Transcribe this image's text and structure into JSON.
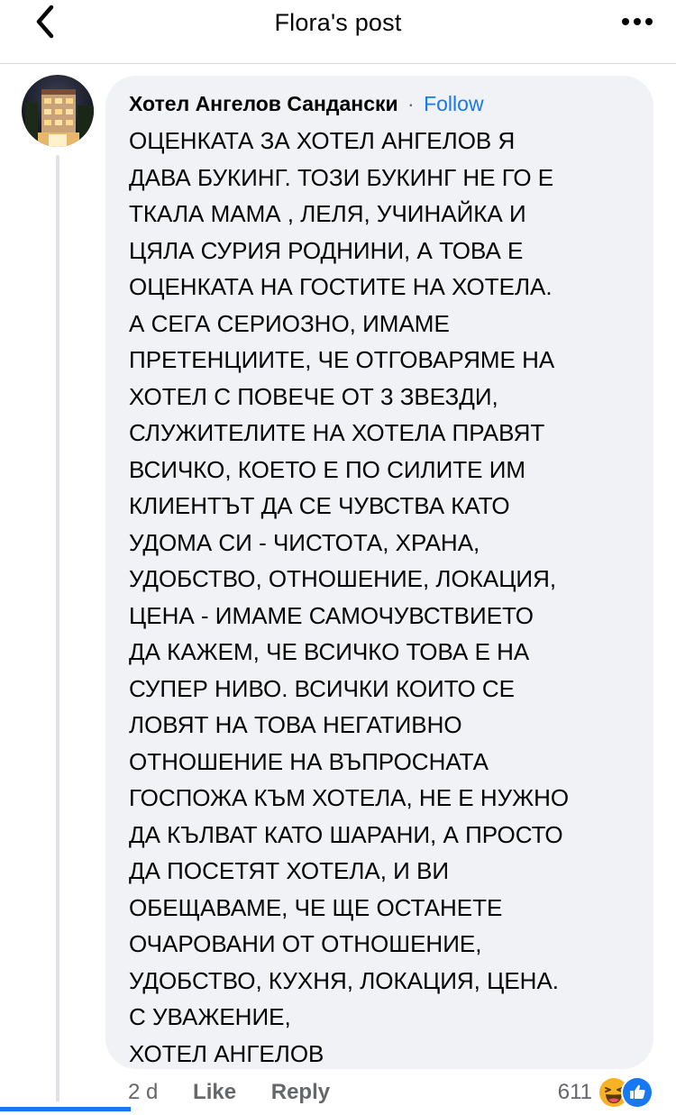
{
  "header": {
    "title": "Flora's post"
  },
  "comment": {
    "author": "Хотел Ангелов Сандански",
    "separator": "·",
    "follow_label": "Follow",
    "lines": [
      "ОЦЕНКАТА ЗА ХОТЕЛ АНГЕЛОВ Я",
      "ДАВА БУКИНГ. ТОЗИ БУКИНГ НЕ ГО Е",
      "ТКАЛА МАМА , ЛЕЛЯ, УЧИНАЙКА И",
      "ЦЯЛА СУРИЯ РОДНИНИ, А ТОВА Е",
      "ОЦЕНКАТА НА ГОСТИТЕ НА ХОТЕЛА.",
      "А СЕГА СЕРИОЗНО, ИМАМЕ",
      "ПРЕТЕНЦИИТЕ, ЧЕ ОТГОВАРЯМЕ НА",
      "ХОТЕЛ С ПОВЕЧЕ ОТ 3 ЗВЕЗДИ,",
      "СЛУЖИТЕЛИТЕ НА ХОТЕЛА ПРАВЯТ",
      "ВСИЧКО, КОЕТО Е ПО СИЛИТЕ ИМ",
      "КЛИЕНТЪТ ДА СЕ ЧУВСТВА КАТО",
      "УДОМА СИ - ЧИСТОТА, ХРАНА,",
      "УДОБСТВО, ОТНОШЕНИЕ, ЛОКАЦИЯ,",
      "ЦЕНА - ИМАМЕ САМОЧУВСТВИЕТО",
      "ДА КАЖЕМ, ЧЕ ВСИЧКО ТОВА Е НА",
      "СУПЕР НИВО. ВСИЧКИ КОИТО СЕ",
      "ЛОВЯТ НА ТОВА НЕГАТИВНО",
      "ОТНОШЕНИЕ НА ВЪПРОСНАТА",
      "ГОСПОЖА КЪМ ХОТЕЛА, НЕ Е НУЖНО",
      "ДА КЪЛВАТ КАТО ШАРАНИ, А ПРОСТО",
      "ДА ПОСЕТЯТ ХОТЕЛА, И ВИ",
      "ОБЕЩАВАМЕ, ЧЕ ЩЕ ОСТАНЕТЕ",
      "ОЧАРОВАНИ ОТ ОТНОШЕНИЕ,",
      "УДОБСТВО, КУХНЯ, ЛОКАЦИЯ, ЦЕНА.",
      "С УВАЖЕНИЕ,",
      "ХОТЕЛ АНГЕЛОВ"
    ],
    "time": "2 d",
    "like_label": "Like",
    "reply_label": "Reply",
    "reaction_count": "611",
    "reaction_icons": [
      "haha-reaction-icon",
      "like-reaction-icon"
    ]
  },
  "colors": {
    "accent": "#1877f2",
    "bubble": "#f0f2f5",
    "secondary_text": "#65676b",
    "haha": "#f7b125"
  }
}
